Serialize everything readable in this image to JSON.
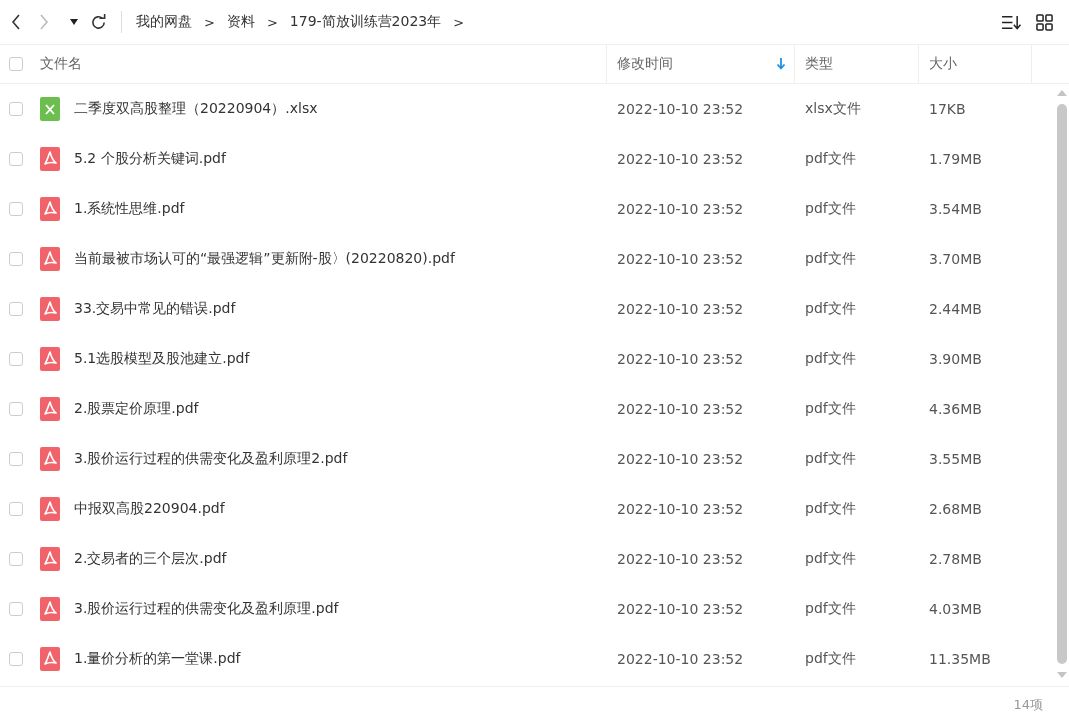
{
  "toolbar": {
    "breadcrumbs": [
      "我的网盘",
      "资料",
      "179-简放训练营2023年"
    ],
    "separator": ">"
  },
  "table": {
    "select_all_checked": false,
    "columns": [
      {
        "label": "文件名",
        "sorted": false
      },
      {
        "label": "修改时间",
        "sorted": true
      },
      {
        "label": "类型",
        "sorted": false
      },
      {
        "label": "大小",
        "sorted": false
      }
    ],
    "rows": [
      {
        "kind": "xlsx",
        "name": "二季度双高股整理（20220904）.xlsx",
        "modified": "2022-10-10 23:52",
        "type": "xlsx文件",
        "size": "17KB",
        "checked": false
      },
      {
        "kind": "pdf",
        "name": "5.2 个股分析关键词.pdf",
        "modified": "2022-10-10 23:52",
        "type": "pdf文件",
        "size": "1.79MB",
        "checked": false
      },
      {
        "kind": "pdf",
        "name": "1.系统性思维.pdf",
        "modified": "2022-10-10 23:52",
        "type": "pdf文件",
        "size": "3.54MB",
        "checked": false
      },
      {
        "kind": "pdf",
        "name": "当前最被市场认可的“最强逻辑”更新附-股〉(20220820).pdf",
        "modified": "2022-10-10 23:52",
        "type": "pdf文件",
        "size": "3.70MB",
        "checked": false
      },
      {
        "kind": "pdf",
        "name": "33.交易中常见的错误.pdf",
        "modified": "2022-10-10 23:52",
        "type": "pdf文件",
        "size": "2.44MB",
        "checked": false
      },
      {
        "kind": "pdf",
        "name": "5.1选股模型及股池建立.pdf",
        "modified": "2022-10-10 23:52",
        "type": "pdf文件",
        "size": "3.90MB",
        "checked": false
      },
      {
        "kind": "pdf",
        "name": "2.股票定价原理.pdf",
        "modified": "2022-10-10 23:52",
        "type": "pdf文件",
        "size": "4.36MB",
        "checked": false
      },
      {
        "kind": "pdf",
        "name": "3.股价运行过程的供需变化及盈利原理2.pdf",
        "modified": "2022-10-10 23:52",
        "type": "pdf文件",
        "size": "3.55MB",
        "checked": false
      },
      {
        "kind": "pdf",
        "name": "中报双高股220904.pdf",
        "modified": "2022-10-10 23:52",
        "type": "pdf文件",
        "size": "2.68MB",
        "checked": false
      },
      {
        "kind": "pdf",
        "name": "2.交易者的三个层次.pdf",
        "modified": "2022-10-10 23:52",
        "type": "pdf文件",
        "size": "2.78MB",
        "checked": false
      },
      {
        "kind": "pdf",
        "name": "3.股价运行过程的供需变化及盈利原理.pdf",
        "modified": "2022-10-10 23:52",
        "type": "pdf文件",
        "size": "4.03MB",
        "checked": false
      },
      {
        "kind": "pdf",
        "name": "1.量价分析的第一堂课.pdf",
        "modified": "2022-10-10 23:52",
        "type": "pdf文件",
        "size": "11.35MB",
        "checked": false
      }
    ]
  },
  "status_bar": {
    "count": "14项"
  }
}
